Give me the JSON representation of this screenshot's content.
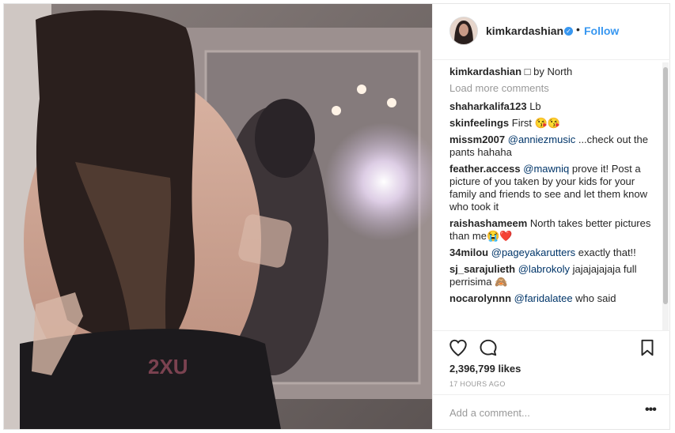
{
  "post": {
    "username": "kimkardashian",
    "follow_label": "Follow",
    "separator": "•",
    "caption_text": "□ by North",
    "image_waistband_text": "2XU"
  },
  "comments": {
    "load_more_label": "Load more comments",
    "items": [
      {
        "user": "shaharkalifa123",
        "text": "Lb"
      },
      {
        "user": "skinfeelings",
        "text": "First 😘😘"
      },
      {
        "user": "missm2007",
        "mention": "@anniezmusic",
        "text": "...check out the pants hahaha"
      },
      {
        "user": "feather.access",
        "mention": "@mawniq",
        "text": "prove it! Post a picture of you taken by your kids for your family and friends to see and let them know who took it"
      },
      {
        "user": "raishashameem",
        "text": "North takes better pictures than me😭❤️"
      },
      {
        "user": "34milou",
        "mention": "@pageyakarutters",
        "text": "exactly that!!"
      },
      {
        "user": "sj_sarajulieth",
        "mention": "@labrokoly",
        "text": "jajajajajaja full perrisima 🙈"
      },
      {
        "user": "nocarolynnn",
        "mention": "@faridalatee",
        "text": "who said"
      }
    ]
  },
  "stats": {
    "likes": "2,396,799 likes",
    "timestamp": "17 HOURS AGO"
  },
  "add_comment": {
    "placeholder": "Add a comment...",
    "more_label": "•••"
  },
  "colors": {
    "link": "#3897f0",
    "mention": "#003569",
    "muted": "#999999"
  },
  "icons": [
    "heart-icon",
    "comment-icon",
    "bookmark-icon",
    "verified-icon",
    "more-icon"
  ]
}
